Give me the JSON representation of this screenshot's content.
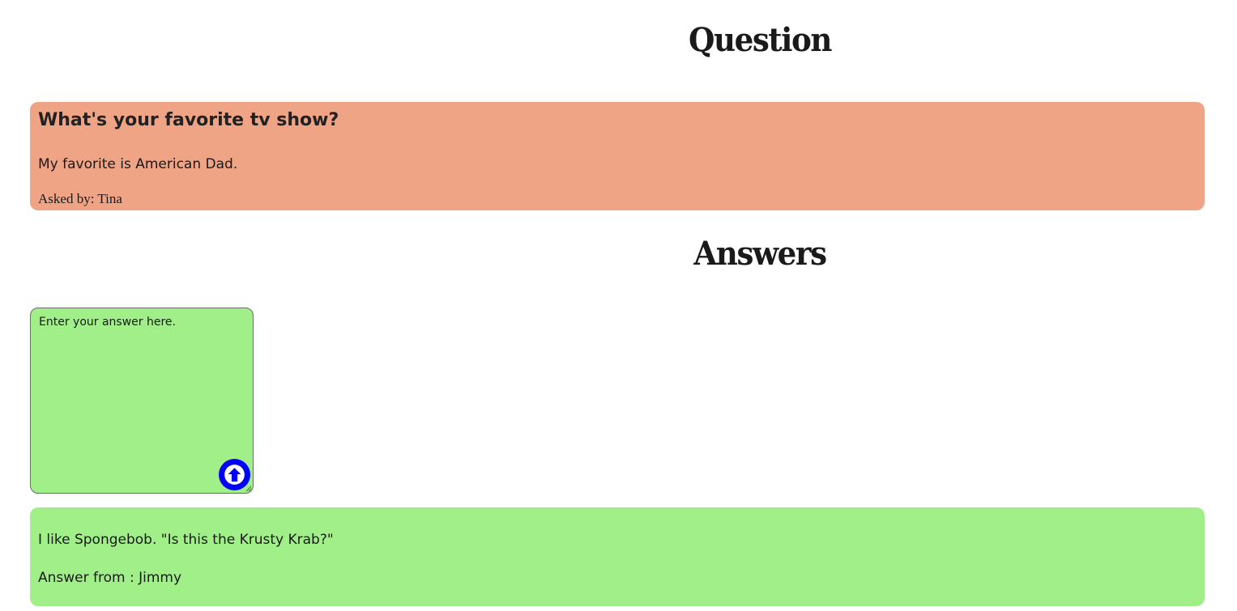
{
  "question_section": {
    "heading": "Question",
    "title": "What's your favorite tv show?",
    "body": "My favorite is American Dad.",
    "asked_by_label": "Asked by:",
    "asked_by": "Tina"
  },
  "answers_section": {
    "heading": "Answers",
    "input": {
      "placeholder": "Enter your answer here.",
      "value": ""
    },
    "submit_icon": "arrow-up-icon",
    "answers": [
      {
        "text": "I like Spongebob. \"Is this the Krusty Krab?\"",
        "from_label": "Answer from :",
        "author": "Jimmy"
      }
    ]
  },
  "colors": {
    "question_card": "#f0a486",
    "answer_card": "#a0ef88",
    "submit_button": "#0000ff"
  }
}
